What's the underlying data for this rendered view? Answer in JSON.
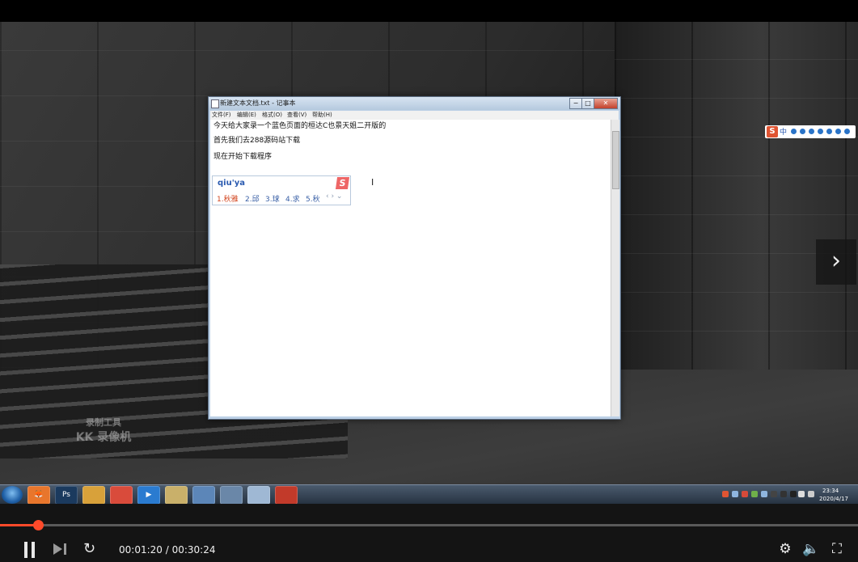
{
  "notepad": {
    "title": "新建文本文档.txt - 记事本",
    "menu": [
      "文件(F)",
      "编辑(E)",
      "格式(O)",
      "查看(V)",
      "帮助(H)"
    ],
    "lines": [
      "今天给大家录一个蓝色页面的桓达C也景天姐二开版的",
      "首先我们去288源码站下载",
      "现在开始下载程序"
    ],
    "window_buttons": {
      "minimize": "−",
      "maximize": "□",
      "close": "✕"
    }
  },
  "ime": {
    "composition": "qiu'ya",
    "logo": "S",
    "candidates": [
      "1.秋雅",
      "2.邱",
      "3.球",
      "4.求",
      "5.秋"
    ],
    "nav": "‹ › ⌄"
  },
  "ime_status": {
    "logo": "S",
    "lang": "中"
  },
  "watermark": {
    "line1": "录制工具",
    "line2": "KK 录像机"
  },
  "taskbar": {
    "apps": [
      {
        "name": "firefox-icon",
        "glyph": "🦊",
        "color": "#e8762c"
      },
      {
        "name": "photoshop-icon",
        "glyph": "Ps",
        "color": "#1b3a5e"
      },
      {
        "name": "app-icon",
        "glyph": "",
        "color": "#d8a13a"
      },
      {
        "name": "chrome-icon",
        "glyph": "",
        "color": "#d94b3b"
      },
      {
        "name": "media-player-icon",
        "glyph": "▶",
        "color": "#2a7bd0"
      },
      {
        "name": "explorer-icon",
        "glyph": "",
        "color": "#c9b06a"
      },
      {
        "name": "computer-icon",
        "glyph": "",
        "color": "#5c86b8"
      },
      {
        "name": "network-icon",
        "glyph": "",
        "color": "#6a87a8"
      },
      {
        "name": "notepad-icon",
        "glyph": "",
        "color": "#9fb8d4"
      },
      {
        "name": "kk-recorder-icon",
        "glyph": "",
        "color": "#c23a2a"
      }
    ],
    "clock_time": "23:34",
    "clock_date": "2020/4/17"
  },
  "player": {
    "current_time": "00:01:20",
    "duration": "00:30:24",
    "time_display": "00:01:20 / 00:30:24",
    "progress": 0.0439,
    "next_slide_glyph": "›"
  },
  "colors": {
    "accent": "#ff4a2a",
    "ime_blue": "#2a5ab0",
    "ime_red": "#d2451f"
  }
}
